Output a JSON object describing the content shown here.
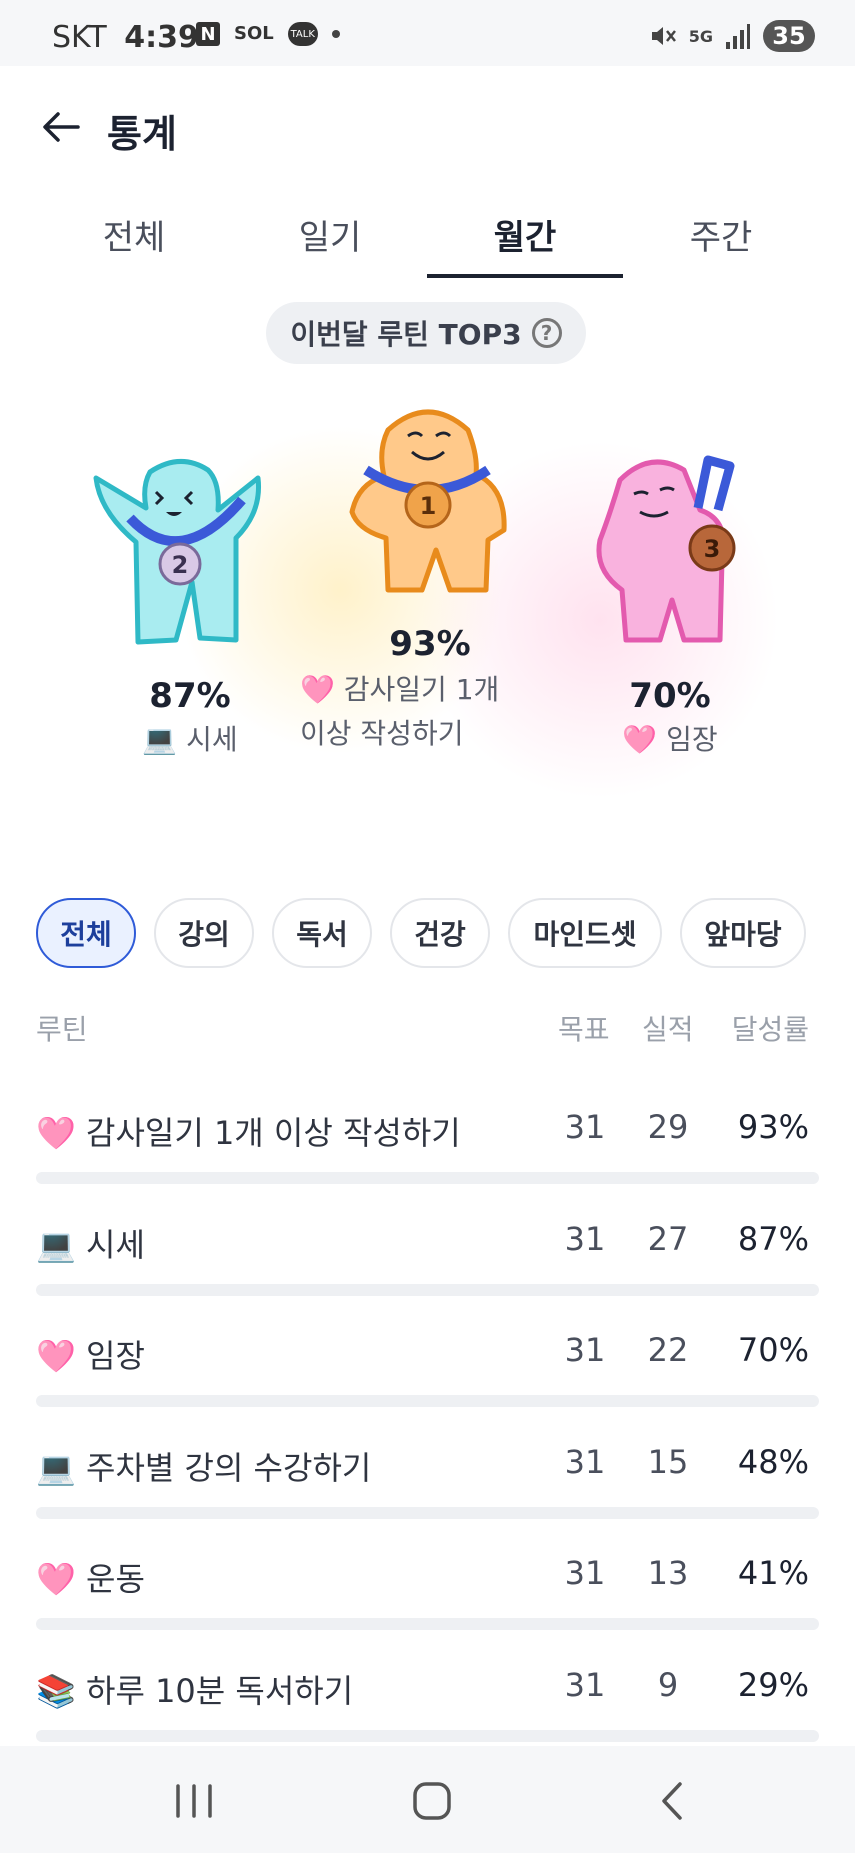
{
  "status": {
    "carrier": "SKT",
    "time": "4:39",
    "icons": [
      "naver-icon",
      "sol-bank-icon",
      "kakaotalk-icon",
      "dot-icon"
    ],
    "sol_text": "SOL",
    "talk_text": "TALK",
    "network": "5G",
    "battery": "35"
  },
  "header": {
    "title": "통계"
  },
  "tabs": [
    "전체",
    "일기",
    "월간",
    "주간"
  ],
  "active_tab": "월간",
  "top3": {
    "label": "이번달 루틴 TOP3",
    "help": "?",
    "items": [
      {
        "rank": "2",
        "percent": "87%",
        "emoji": "💻",
        "name": "시세",
        "color": "#4ec9d2"
      },
      {
        "rank": "1",
        "percent": "93%",
        "emoji": "🩷",
        "name": "감사일기 1개",
        "name2": "이상 작성하기",
        "color": "#f3a23b"
      },
      {
        "rank": "3",
        "percent": "70%",
        "emoji": "🩷",
        "name": "임장",
        "color": "#ef78c0"
      }
    ]
  },
  "filters": [
    "전체",
    "강의",
    "독서",
    "건강",
    "마인드셋",
    "앞마당"
  ],
  "active_filter": "전체",
  "table": {
    "headers": {
      "routine": "루틴",
      "goal": "목표",
      "done": "실적",
      "rate": "달성률"
    },
    "rows": [
      {
        "emoji": "🩷",
        "name": "감사일기 1개 이상 작성하기",
        "goal": "31",
        "done": "29",
        "rate": "93%",
        "progress": 0.93
      },
      {
        "emoji": "💻",
        "name": "시세",
        "goal": "31",
        "done": "27",
        "rate": "87%",
        "progress": 0.87
      },
      {
        "emoji": "🩷",
        "name": "임장",
        "goal": "31",
        "done": "22",
        "rate": "70%",
        "progress": 0.7
      },
      {
        "emoji": "💻",
        "name": "주차별 강의 수강하기",
        "goal": "31",
        "done": "15",
        "rate": "48%",
        "progress": 0.48
      },
      {
        "emoji": "🩷",
        "name": "운동",
        "goal": "31",
        "done": "13",
        "rate": "41%",
        "progress": 0.41
      },
      {
        "emoji": "📚",
        "name": "하루 10분 독서하기",
        "goal": "31",
        "done": "9",
        "rate": "29%",
        "progress": 0.29
      }
    ]
  },
  "colors": {
    "accent": "#1c2230",
    "chip_active_bg": "#eaf1ff",
    "chip_active_border": "#2f5bd8",
    "bar_track": "#eef0f3"
  }
}
